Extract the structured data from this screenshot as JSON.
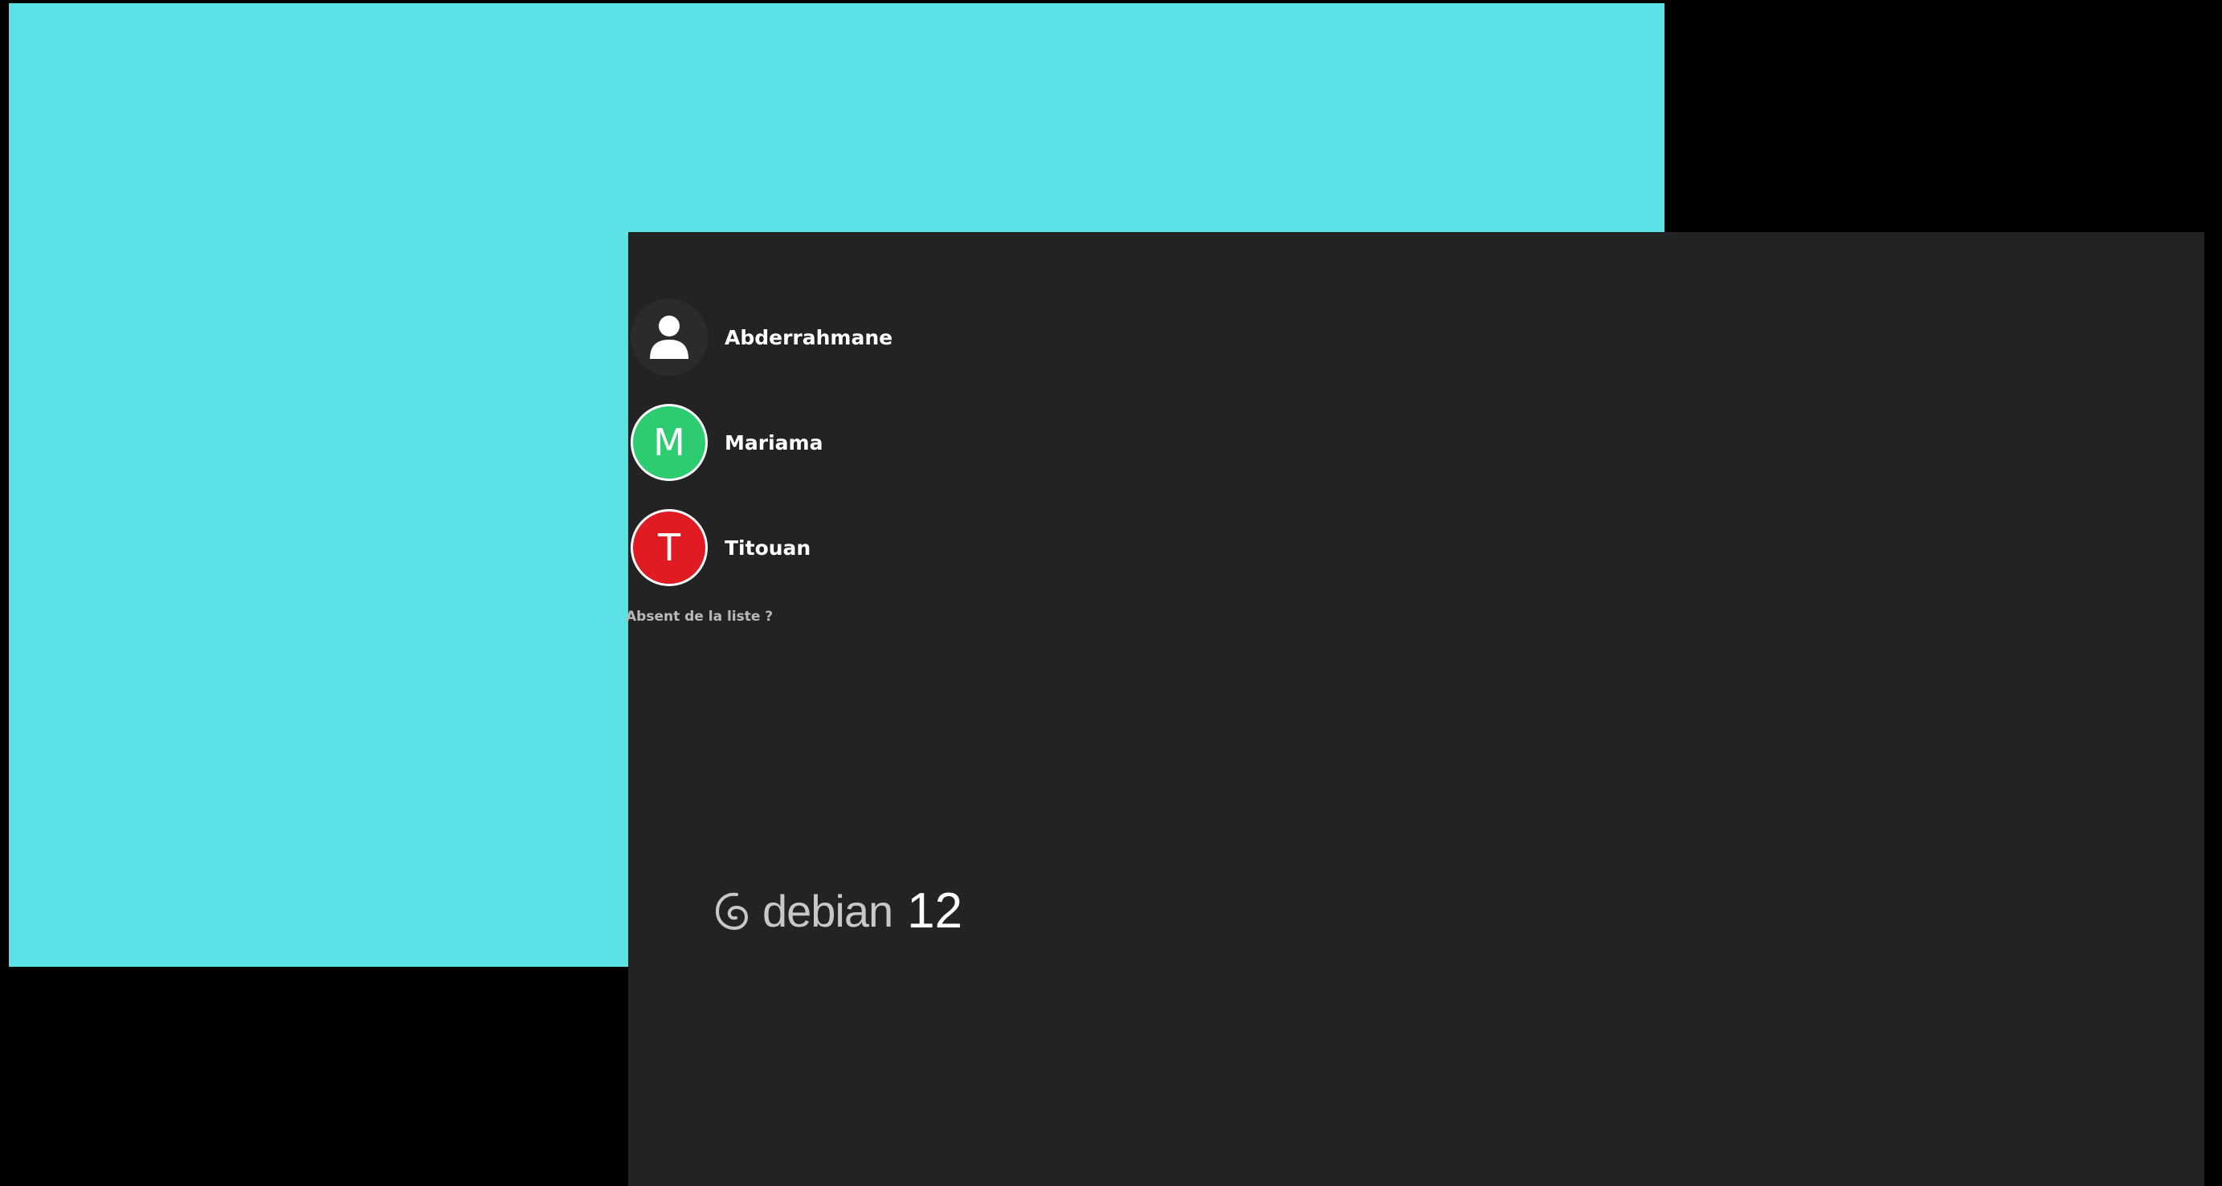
{
  "colors": {
    "background": "#000000",
    "secondary_monitor": "#5ce2e6",
    "primary_monitor": "#232323",
    "generic_avatar": "#2b2b2b",
    "user_text": "#ffffff",
    "link_text": "#b9b9b9"
  },
  "users": [
    {
      "name": "Abderrahmane",
      "avatar_type": "person-icon",
      "avatar_letter": "",
      "avatar_color": "#2b2b2b"
    },
    {
      "name": "Mariama",
      "avatar_type": "letter",
      "avatar_letter": "M",
      "avatar_color": "#2ecc71"
    },
    {
      "name": "Titouan",
      "avatar_type": "letter",
      "avatar_letter": "T",
      "avatar_color": "#e01b24"
    }
  ],
  "not_listed_label": "Absent de la liste ?",
  "logo": {
    "icon": "debian-swirl-icon",
    "word": "debian",
    "version": "12"
  }
}
